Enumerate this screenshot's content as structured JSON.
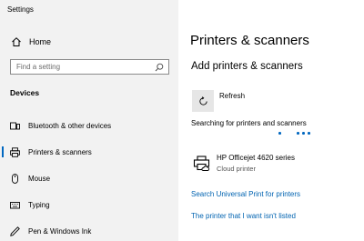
{
  "window": {
    "title": "Settings"
  },
  "sidebar": {
    "home_label": "Home",
    "search_placeholder": "Find a setting",
    "section_title": "Devices",
    "items": [
      {
        "label": "Bluetooth & other devices",
        "icon": "bluetooth-devices-icon",
        "selected": false
      },
      {
        "label": "Printers & scanners",
        "icon": "printer-icon",
        "selected": true
      },
      {
        "label": "Mouse",
        "icon": "mouse-icon",
        "selected": false
      },
      {
        "label": "Typing",
        "icon": "keyboard-icon",
        "selected": false
      },
      {
        "label": "Pen & Windows Ink",
        "icon": "pen-icon",
        "selected": false
      }
    ]
  },
  "main": {
    "page_title": "Printers & scanners",
    "add_title": "Add printers & scanners",
    "refresh_label": "Refresh",
    "searching_text": "Searching for printers and scanners",
    "printer": {
      "name": "HP Officejet 4620 series",
      "type": "Cloud printer"
    },
    "links": [
      "Search Universal Print for printers",
      "The printer that I want isn't listed"
    ]
  },
  "colors": {
    "accent": "#0067c0",
    "link": "#0063b1",
    "sidebar_bg": "#f2f2f2"
  }
}
